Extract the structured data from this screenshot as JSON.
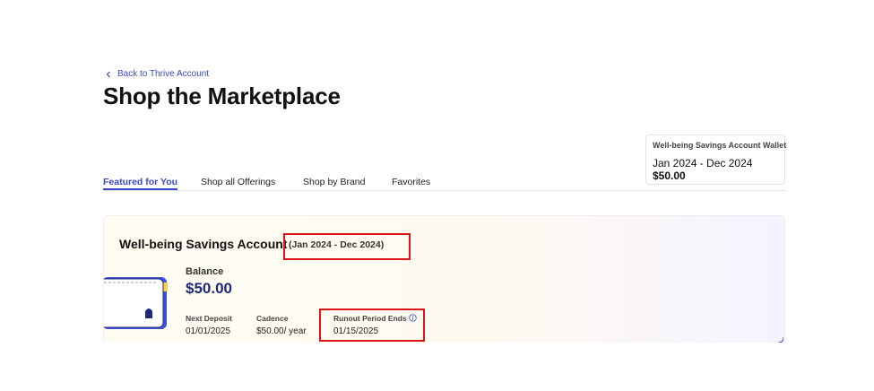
{
  "nav": {
    "back_label": "Back to Thrive Account"
  },
  "page": {
    "title": "Shop the Marketplace"
  },
  "wallet": {
    "title": "Well-being Savings Account Wallet",
    "period": "Jan 2024 - Dec 2024",
    "amount": "$50.00"
  },
  "tabs": [
    {
      "label": "Featured for You",
      "active": true
    },
    {
      "label": "Shop all Offerings",
      "active": false
    },
    {
      "label": "Shop by Brand",
      "active": false
    },
    {
      "label": "Favorites",
      "active": false
    }
  ],
  "account": {
    "title": "Well-being Savings Account",
    "period": "(Jan 2024 - Dec 2024)",
    "balance_label": "Balance",
    "balance_value": "$50.00",
    "next_deposit_label": "Next Deposit",
    "next_deposit_value": "01/01/2025",
    "cadence_label": "Cadence",
    "cadence_value": "$50.00/ year",
    "runout_label": "Runout Period Ends",
    "runout_value": "01/15/2025"
  },
  "colors": {
    "accent": "#3b47c8",
    "highlight": "#d9141b",
    "balance": "#1e2a78"
  },
  "icons": {
    "back": "chevron-left-icon",
    "info": "info-icon",
    "card": "wallet-card-illustration"
  }
}
